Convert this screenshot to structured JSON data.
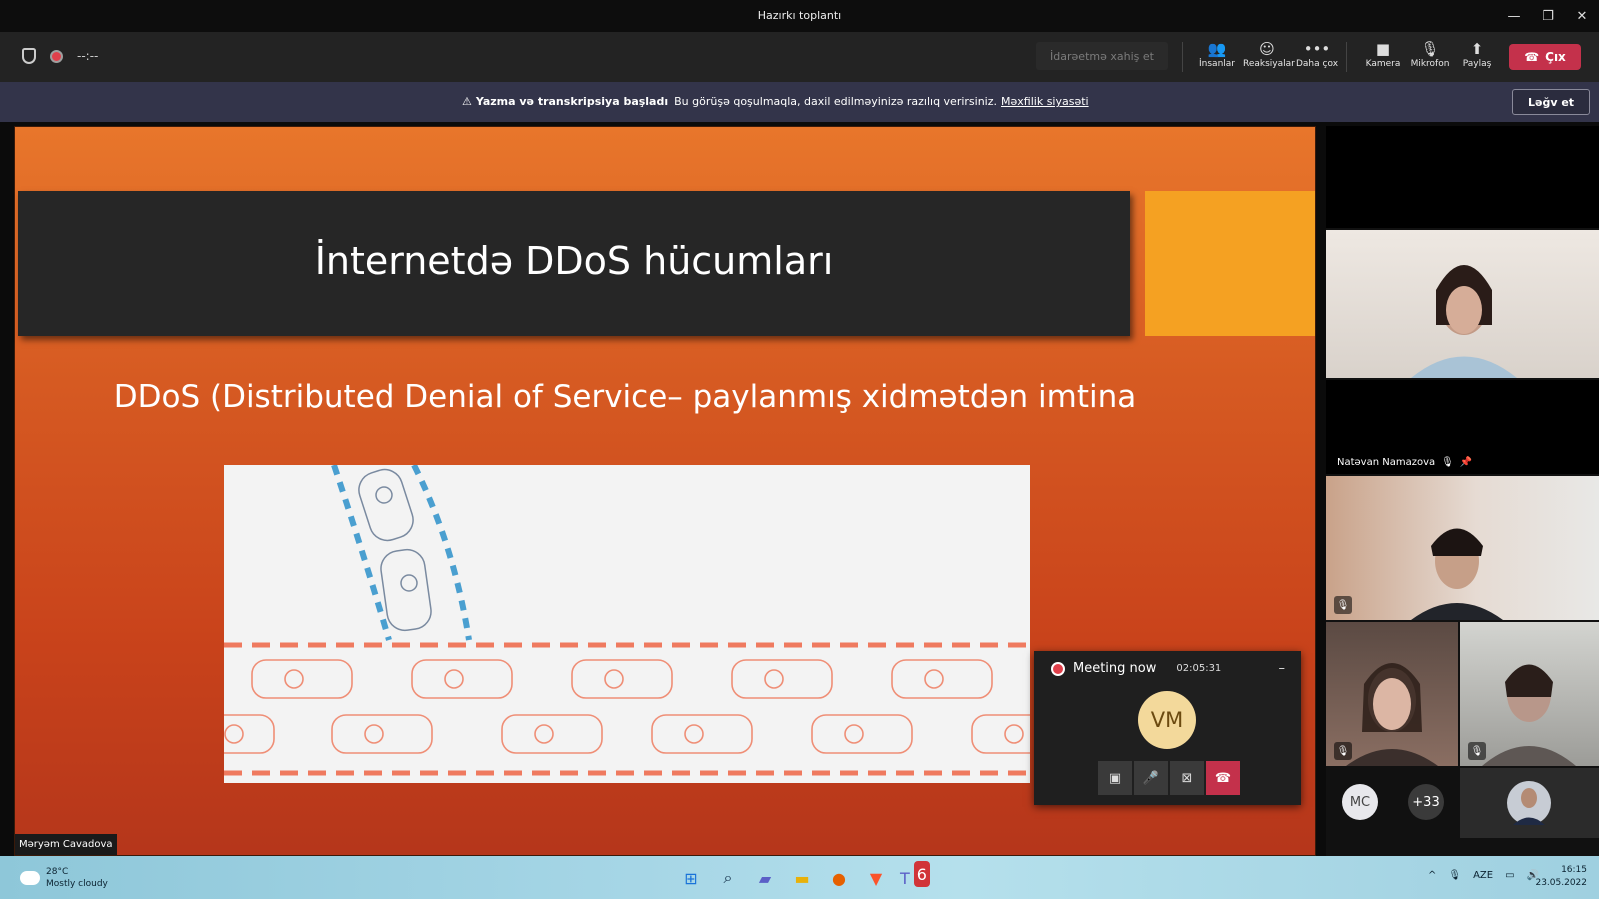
{
  "window": {
    "title": "Hazırkı toplantı"
  },
  "toolbar": {
    "timer": "--:--",
    "request_control": "İdarəetmə xahiş et",
    "buttons": [
      {
        "label": "İnsanlar",
        "icon": "people-icon"
      },
      {
        "label": "Reaksiyalar",
        "icon": "reactions-icon"
      },
      {
        "label": "Daha çox",
        "icon": "more-icon"
      },
      {
        "label": "Kamera",
        "icon": "camera-off-icon"
      },
      {
        "label": "Mikrofon",
        "icon": "mic-off-icon"
      },
      {
        "label": "Paylaş",
        "icon": "share-icon"
      }
    ],
    "leave_label": "Çıx"
  },
  "banner": {
    "title": "Yazma və transkripsiya başladı",
    "text": "Bu görüşə qoşulmaqla, daxil edilməyinizə razılıq verirsiniz.",
    "link": "Məxfilik siyasəti",
    "dismiss": "Ləğv et"
  },
  "slide": {
    "title": "İnternetdə DDoS hücumları",
    "subtitle": "DDoS (Distributed Denial of Service– paylanmış xidmətdən imtina",
    "presenter": "Məryəm Cavadova"
  },
  "mini_meeting": {
    "name": "Meeting now",
    "time": "02:05:31",
    "avatar_initials": "VM"
  },
  "participants": {
    "pinned_name": "Natəvan Namazova",
    "chip_initials": "MC",
    "more_count": "+33"
  },
  "taskbar": {
    "temperature": "28°C",
    "weather": "Mostly cloudy",
    "language": "AZE",
    "time": "16:15",
    "date": "23.05.2022",
    "teams_badge": "6"
  },
  "colors": {
    "leave": "#c4314b",
    "banner": "#33344a",
    "slide_orange": "#f5a122",
    "slide_title_bg": "#262626"
  }
}
